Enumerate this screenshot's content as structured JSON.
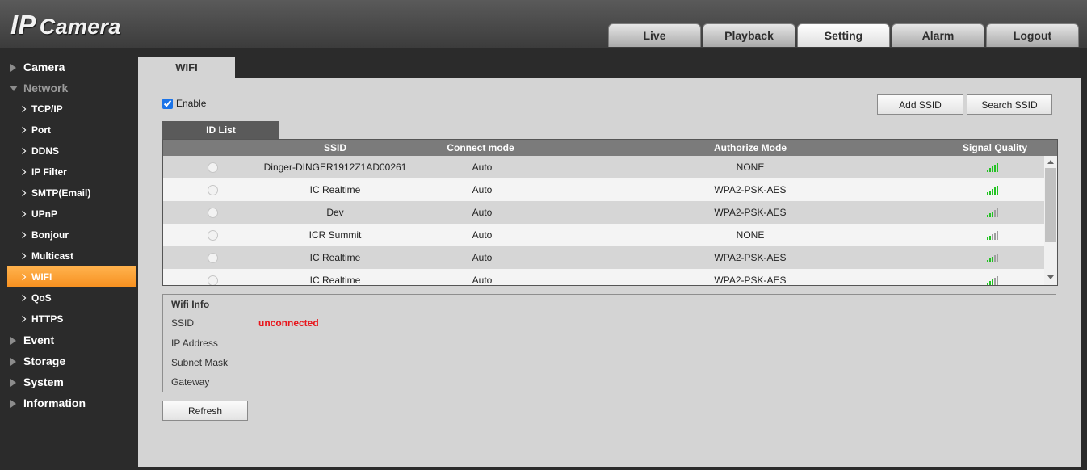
{
  "app": {
    "logo_ip": "IP",
    "logo_camera": "Camera"
  },
  "nav": [
    "Live",
    "Playback",
    "Setting",
    "Alarm",
    "Logout"
  ],
  "nav_active": "Setting",
  "sidebar": {
    "camera": "Camera",
    "network": "Network",
    "network_items": [
      "TCP/IP",
      "Port",
      "DDNS",
      "IP Filter",
      "SMTP(Email)",
      "UPnP",
      "Bonjour",
      "Multicast",
      "WIFI",
      "QoS",
      "HTTPS"
    ],
    "active_item": "WIFI",
    "event": "Event",
    "storage": "Storage",
    "system": "System",
    "information": "Information"
  },
  "page": {
    "tab": "WIFI",
    "enable_label": "Enable",
    "enable_checked": true,
    "add_ssid": "Add SSID",
    "search_ssid": "Search SSID",
    "id_list_tab": "ID List",
    "refresh": "Refresh"
  },
  "table": {
    "headers": {
      "ssid": "SSID",
      "mode": "Connect mode",
      "auth": "Authorize Mode",
      "signal": "Signal Quality"
    },
    "rows": [
      {
        "ssid": "Dinger-DINGER1912Z1AD00261",
        "mode": "Auto",
        "auth": "NONE",
        "signal": 5
      },
      {
        "ssid": "IC Realtime",
        "mode": "Auto",
        "auth": "WPA2-PSK-AES",
        "signal": 5
      },
      {
        "ssid": "Dev",
        "mode": "Auto",
        "auth": "WPA2-PSK-AES",
        "signal": 3
      },
      {
        "ssid": "ICR Summit",
        "mode": "Auto",
        "auth": "NONE",
        "signal": 2
      },
      {
        "ssid": "IC Realtime",
        "mode": "Auto",
        "auth": "WPA2-PSK-AES",
        "signal": 3
      },
      {
        "ssid": "IC Realtime",
        "mode": "Auto",
        "auth": "WPA2-PSK-AES",
        "signal": 3
      }
    ]
  },
  "wifi_info": {
    "title": "Wifi Info",
    "ssid_label": "SSID",
    "ssid_value": "unconnected",
    "ip_label": "IP Address",
    "mask_label": "Subnet Mask",
    "gateway_label": "Gateway"
  },
  "colors": {
    "accent": "#f7901f",
    "signal_on": "#22c322",
    "signal_off": "#9e9e9e",
    "error": "#e8161c"
  },
  "icons": {
    "checkbox": "checkbox-checked-icon",
    "signal": "signal-bars-icon",
    "expand": "triangle-right-icon",
    "collapse": "triangle-down-icon",
    "sub_item": "chevron-right-icon"
  }
}
